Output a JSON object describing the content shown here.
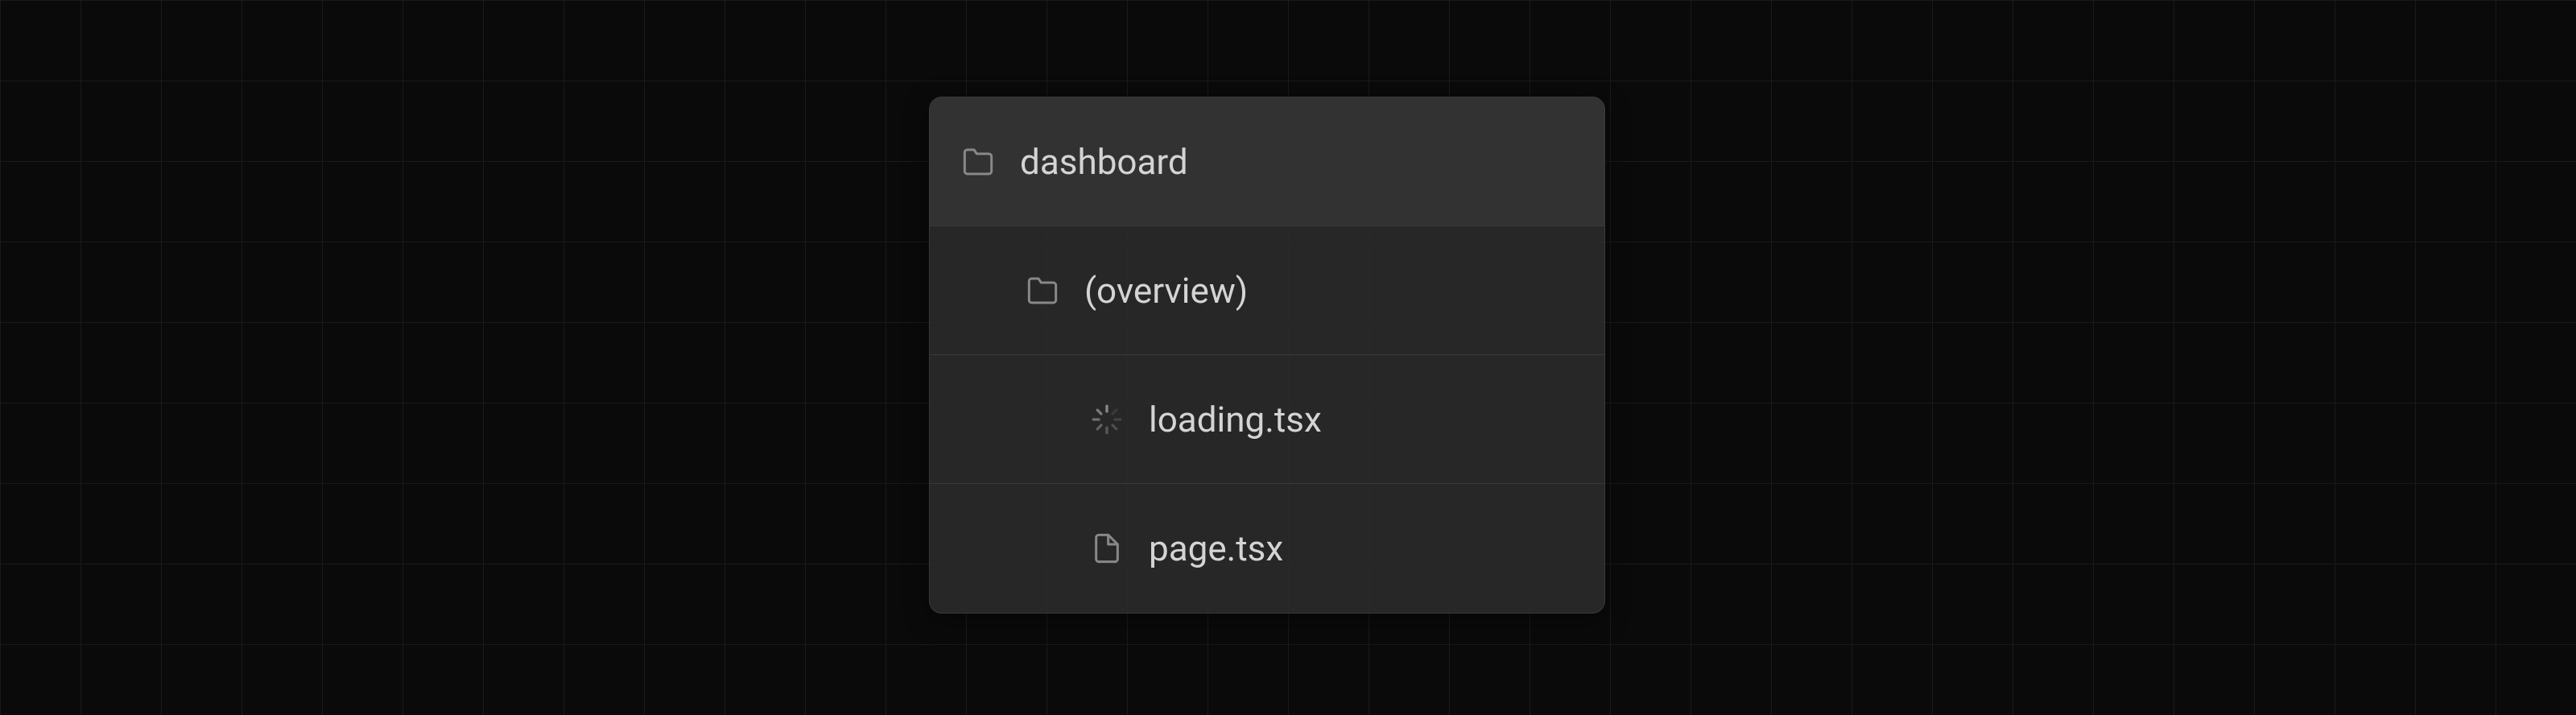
{
  "tree": {
    "root": {
      "name": "dashboard",
      "icon": "folder"
    },
    "items": [
      {
        "name": "(overview)",
        "icon": "folder",
        "depth": 1
      },
      {
        "name": "loading.tsx",
        "icon": "spinner",
        "depth": 2
      },
      {
        "name": "page.tsx",
        "icon": "file",
        "depth": 2
      }
    ]
  },
  "colors": {
    "iconStroke": "#888888",
    "text": "#d4d4d4",
    "bg": "#0a0a0a",
    "panelBg": "#2d2d2d",
    "border": "#3a3a3a"
  }
}
